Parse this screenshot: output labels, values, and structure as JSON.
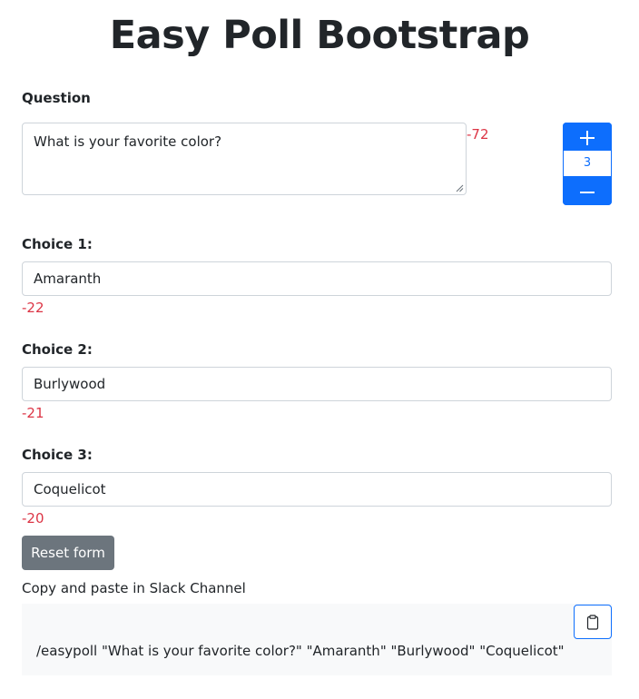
{
  "app": {
    "title": "Easy Poll Bootstrap"
  },
  "question": {
    "label": "Question",
    "value": "What is your favorite color?",
    "remaining": "-72"
  },
  "choice_stepper": {
    "count": "3",
    "increment_icon": "plus-icon",
    "decrement_icon": "minus-icon"
  },
  "choices": [
    {
      "label": "Choice 1:",
      "value": "Amaranth",
      "remaining": "-22"
    },
    {
      "label": "Choice 2:",
      "value": "Burlywood",
      "remaining": "-21"
    },
    {
      "label": "Choice 3:",
      "value": "Coquelicot",
      "remaining": "-20"
    }
  ],
  "actions": {
    "reset_label": "Reset form"
  },
  "output": {
    "hint": "Copy and paste in Slack Channel",
    "command": "/easypoll \"What is your favorite color?\" \"Amaranth\" \"Burlywood\" \"Coquelicot\"",
    "copy_icon": "clipboard-icon"
  },
  "colors": {
    "primary": "#0d6efd",
    "secondary": "#6c757d",
    "danger": "#dc3545",
    "light_bg": "#f8f9fa"
  }
}
